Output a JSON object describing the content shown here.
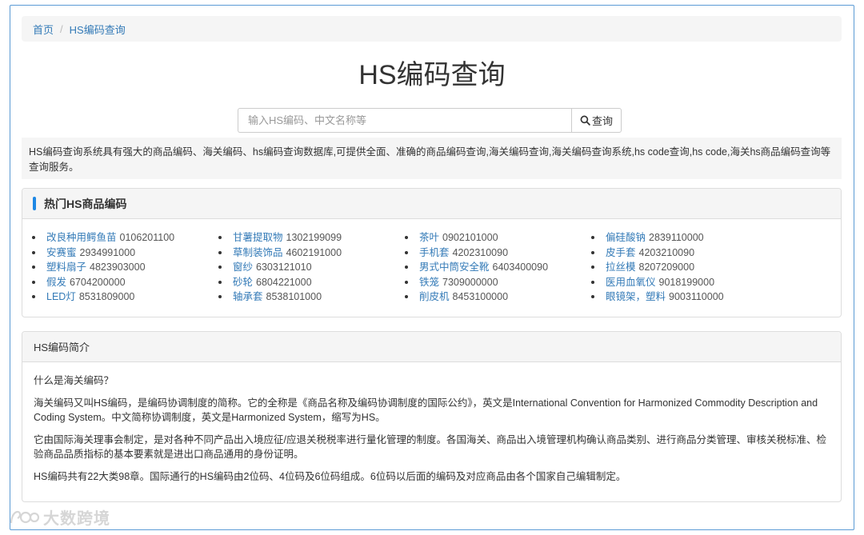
{
  "breadcrumb": {
    "home": "首页",
    "current": "HS编码查询"
  },
  "page_title": "HS编码查询",
  "search": {
    "placeholder": "输入HS编码、中文名称等",
    "button_label": "查询"
  },
  "intro_text": "HS编码查询系统具有强大的商品编码、海关编码、hs编码查询数据库,可提供全面、准确的商品编码查询,海关编码查询,海关编码查询系统,hs code查询,hs code,海关hs商品编码查询等查询服务。",
  "hot": {
    "title": "热门HS商品编码",
    "columns": [
      [
        {
          "name": "改良种用鳄鱼苗",
          "code": "0106201100"
        },
        {
          "name": "安赛蜜",
          "code": "2934991000"
        },
        {
          "name": "塑料扇子",
          "code": "4823903000"
        },
        {
          "name": "假发",
          "code": "6704200000"
        },
        {
          "name": "LED灯",
          "code": "8531809000"
        }
      ],
      [
        {
          "name": "甘薯提取物",
          "code": "1302199099"
        },
        {
          "name": "草制装饰品",
          "code": "4602191000"
        },
        {
          "name": "窗纱",
          "code": "6303121010"
        },
        {
          "name": "砂轮",
          "code": "6804221000"
        },
        {
          "name": "轴承套",
          "code": "8538101000"
        }
      ],
      [
        {
          "name": "茶叶",
          "code": "0902101000"
        },
        {
          "name": "手机套",
          "code": "4202310090"
        },
        {
          "name": "男式中筒安全靴",
          "code": "6403400090"
        },
        {
          "name": "铁笼",
          "code": "7309000000"
        },
        {
          "name": "削皮机",
          "code": "8453100000"
        }
      ],
      [
        {
          "name": "偏硅酸钠",
          "code": "2839110000"
        },
        {
          "name": "皮手套",
          "code": "4203210090"
        },
        {
          "name": "拉丝模",
          "code": "8207209000"
        },
        {
          "name": "医用血氧仪",
          "code": "9018199000"
        },
        {
          "name": "眼镜架，塑料",
          "code": "9003110000"
        }
      ]
    ]
  },
  "hs_intro": {
    "title": "HS编码简介",
    "paragraphs": [
      "什么是海关编码？",
      "海关编码又叫HS编码，是编码协调制度的简称。它的全称是《商品名称及编码协调制度的国际公约》，英文是International Convention for Harmonized Commodity Description and Coding System。中文简称协调制度，英文是Harmonized System，缩写为HS。",
      "它由国际海关理事会制定，是对各种不同产品出入境应征/应退关税税率进行量化管理的制度。各国海关、商品出入境管理机构确认商品类别、进行商品分类管理、审核关税标准、检验商品品质指标的基本要素就是进出口商品通用的身份证明。",
      "HS编码共有22大类98章。国际通行的HS编码由2位码、4位码及6位码组成。6位码以后面的编码及对应商品由各个国家自己编辑制定。"
    ]
  },
  "watermark": "大数跨境"
}
